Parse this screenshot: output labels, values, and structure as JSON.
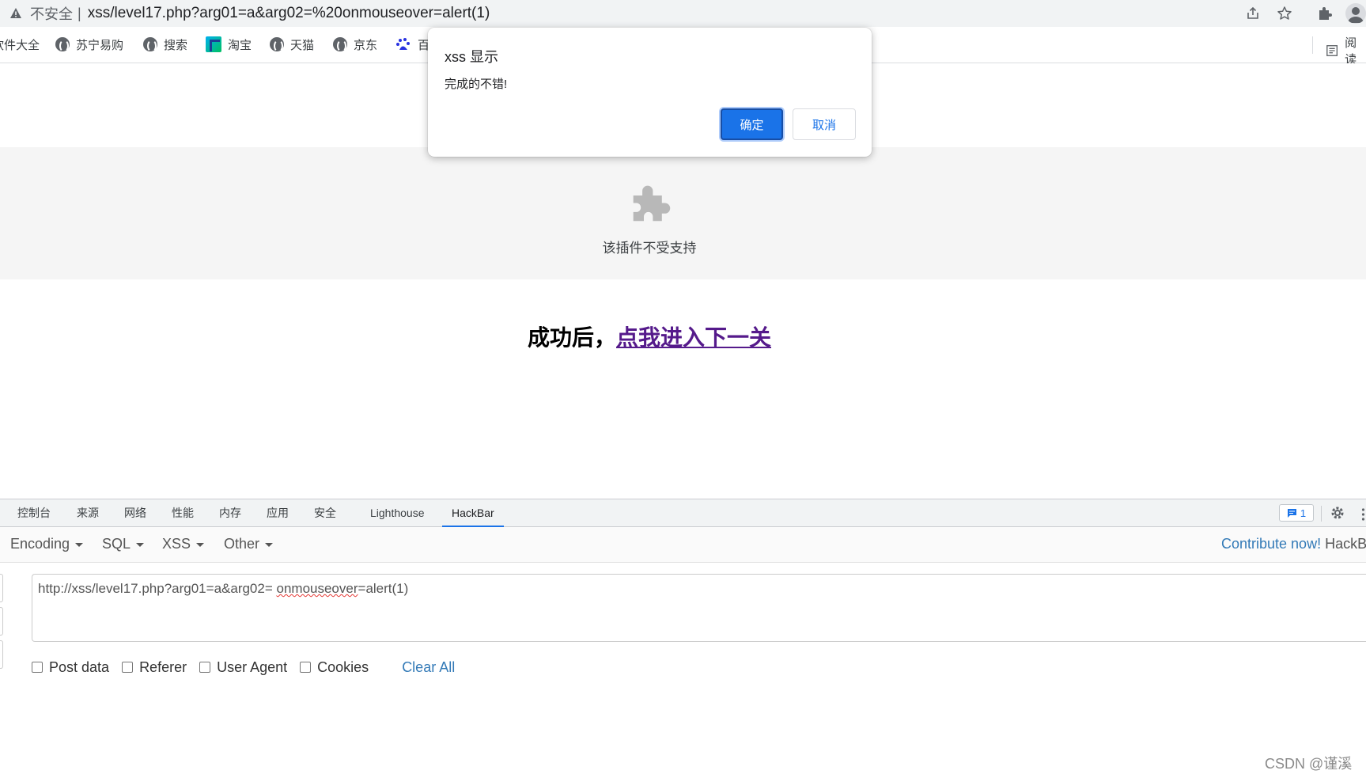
{
  "browser": {
    "security_label": "不安全",
    "separator": "|",
    "url": "xss/level17.php?arg01=a&arg02=%20onmouseover=alert(1)"
  },
  "bookmarks": {
    "items": [
      {
        "label": "软件大全",
        "icon": "none"
      },
      {
        "label": "苏宁易购",
        "icon": "globe-icon"
      },
      {
        "label": "搜索",
        "icon": "globe-icon"
      },
      {
        "label": "淘宝",
        "icon": "taobao-icon"
      },
      {
        "label": "天猫",
        "icon": "globe-icon"
      },
      {
        "label": "京东",
        "icon": "globe-icon"
      },
      {
        "label": "百",
        "icon": "baidu-icon"
      }
    ],
    "reading_list": "阅读"
  },
  "page": {
    "plugin_message": "该插件不受支持",
    "success_prefix": "成功后，",
    "next_level_link": "点我进入下一关"
  },
  "dialog": {
    "title": "xss 显示",
    "message": "完成的不错!",
    "ok_label": "确定",
    "cancel_label": "取消"
  },
  "devtools": {
    "tabs": [
      "控制台",
      "来源",
      "网络",
      "性能",
      "内存",
      "应用",
      "安全",
      "Lighthouse",
      "HackBar"
    ],
    "active_tab": "HackBar",
    "issues_count": "1"
  },
  "hackbar": {
    "menus": [
      "Encoding",
      "SQL",
      "XSS",
      "Other"
    ],
    "contribute": "Contribute now!",
    "brand": "HackBa",
    "url_prefix": "http://xss/level17.php?arg01=a&arg02= ",
    "url_flagged": "onmouseover",
    "url_suffix": "=alert(1)",
    "options": [
      "Post data",
      "Referer",
      "User Agent",
      "Cookies"
    ],
    "clear_all": "Clear All"
  },
  "watermark": "CSDN @谨溪",
  "colors": {
    "accent": "#1a73e8",
    "link_visited": "#551a8b",
    "hackbar_link": "#337ab7"
  }
}
